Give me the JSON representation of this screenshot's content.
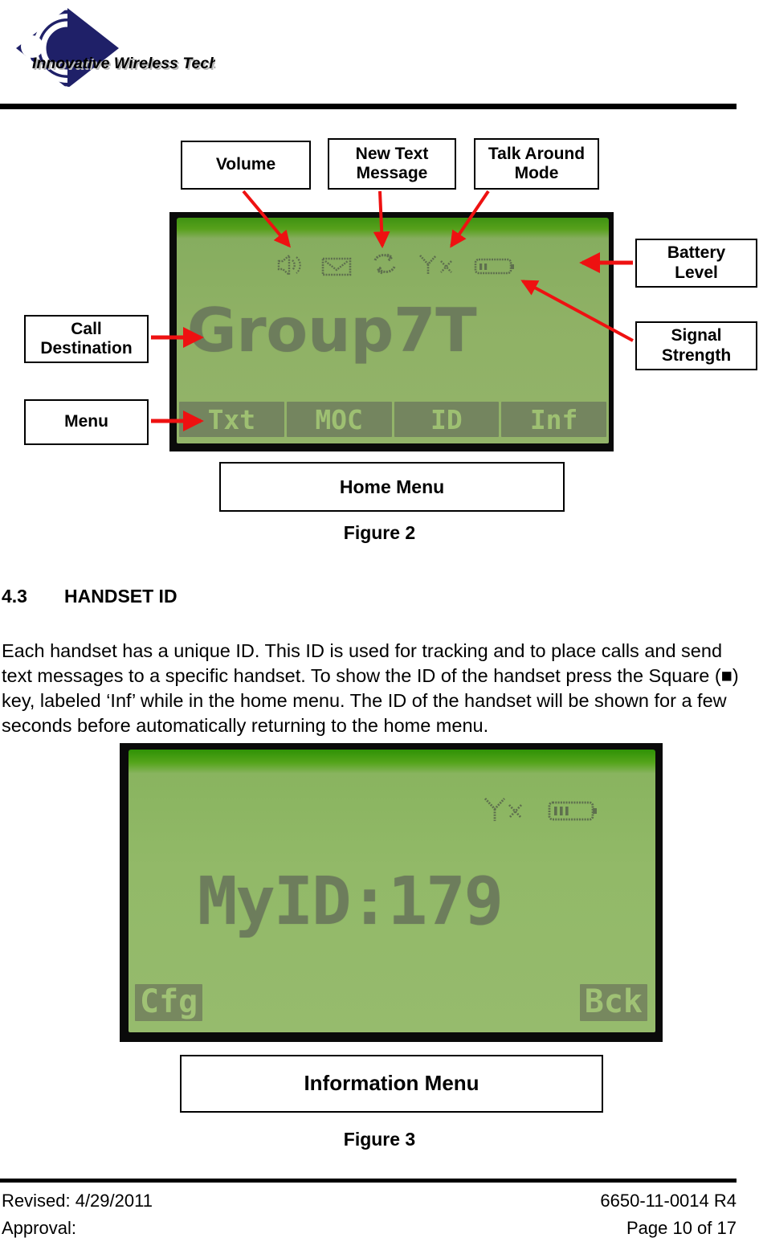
{
  "header": {
    "logo_text": "Innovative Wireless Technologies",
    "logo_color": "#1f2068"
  },
  "figure2": {
    "caption": "Figure 2",
    "callouts": {
      "volume": "Volume",
      "new_text_message_line1": "New Text",
      "new_text_message_line2": "Message",
      "talk_around_line1": "Talk Around",
      "talk_around_line2": "Mode",
      "battery_line1": "Battery",
      "battery_line2": "Level",
      "signal_line1": "Signal",
      "signal_line2": "Strength",
      "call_destination_line1": "Call",
      "call_destination_line2": "Destination",
      "menu": "Menu",
      "home_menu": "Home Menu"
    },
    "lcd": {
      "main_text": "Group7T",
      "status_icons": [
        "volume-speaker-icon",
        "envelope-icon",
        "talk-around-arrows-icon",
        "antenna-no-signal-icon",
        "battery-icon"
      ],
      "battery_bars": 2,
      "softkeys": [
        "Txt",
        "MOC",
        "ID",
        "Inf"
      ]
    }
  },
  "section": {
    "number": "4.3",
    "title": "HANDSET ID",
    "paragraph": "Each handset has a unique ID.  This ID is used for tracking and to place calls and send text messages to a specific handset.  To show the ID of the handset press the Square (■) key, labeled ‘Inf’ while in the home menu.  The ID of the handset will be shown for a few seconds before automatically returning to the home menu."
  },
  "figure3": {
    "caption": "Figure 3",
    "callouts": {
      "information_menu": "Information Menu"
    },
    "lcd": {
      "main_text": "MyID:179",
      "status_icons": [
        "antenna-no-signal-icon",
        "battery-icon"
      ],
      "battery_bars": 3,
      "softkey_left": "Cfg",
      "softkey_right": "Bck"
    }
  },
  "footer": {
    "revised_label": "Revised: 4/29/2011",
    "approval_label": "Approval:",
    "doc_number": "6650-11-0014 R4",
    "page_number": "Page 10 of 17"
  },
  "colors": {
    "arrow": "#ee1111",
    "lcd_background": "#92b669",
    "lcd_ink": "#5e6f4e",
    "logo_navy": "#1f2068"
  }
}
